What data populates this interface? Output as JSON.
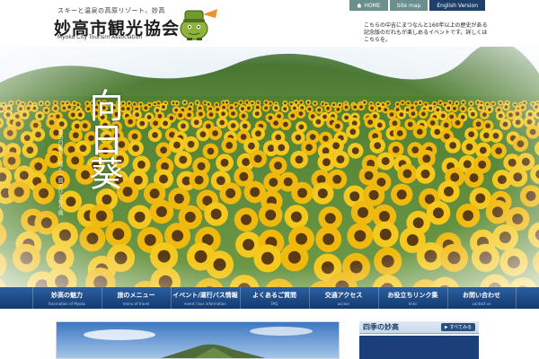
{
  "header": {
    "tagline": "スキーと温泉の高原リゾート、妙高",
    "title": "妙高市観光協会",
    "subtitle": "Myoko City Tourism Association",
    "mascot_icon": "mascot-character-icon",
    "notice": "こちらの中吉にまつなんと160年以上の歴史がある記念版のだれもが楽しめるイベントです。詳しくはこちらを。"
  },
  "topnav": {
    "home": "HOME",
    "sitemap": "Site map",
    "english": "English Version"
  },
  "hero": {
    "caption": "向日葵",
    "poem": "夏の日差しに咲く一面のひまわり畑"
  },
  "mainnav": [
    {
      "jp": "妙高の魅力",
      "en": "fascination of Myoko"
    },
    {
      "jp": "旅のメニュー",
      "en": "menu of travel"
    },
    {
      "jp": "イベント/運行バス情報",
      "en": "event / bus information"
    },
    {
      "jp": "よくあるご質問",
      "en": "FAQ"
    },
    {
      "jp": "交通アクセス",
      "en": "access"
    },
    {
      "jp": "お役立ちリンク集",
      "en": "links"
    },
    {
      "jp": "お問い合わせ",
      "en": "contact us"
    }
  ],
  "sidebar": {
    "title": "四季の妙高",
    "more": "すべてみる"
  },
  "colors": {
    "nav_top": "#2c5fa0",
    "nav_bottom": "#123a70",
    "english_button": "#1f3f6b",
    "home_button": "#6b8f8f"
  }
}
